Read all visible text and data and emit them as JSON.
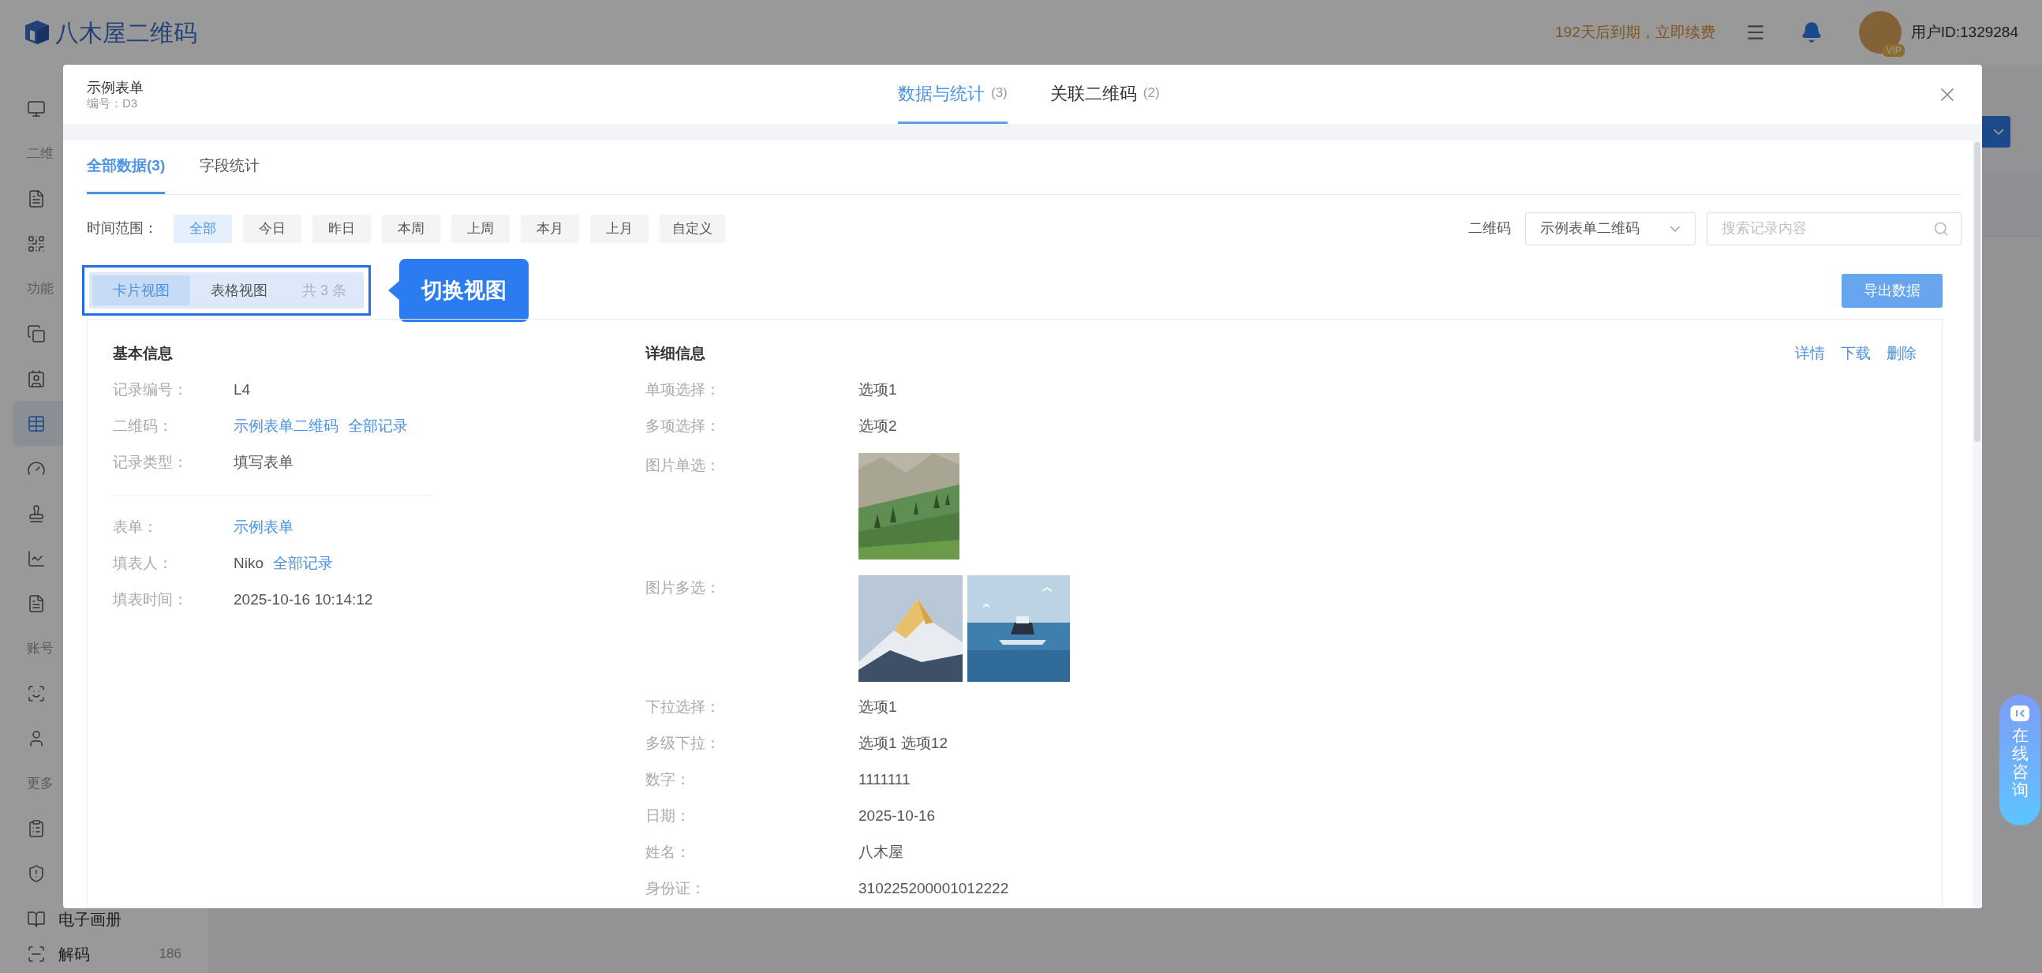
{
  "header": {
    "logo_text": "八木屋二维码",
    "renewal": "192天后到期，立即续费",
    "vip_badge": "VIP",
    "user_id": "用户ID:1329284"
  },
  "sidebar": {
    "items": [
      {
        "kind": "item",
        "selected": false
      },
      {
        "kind": "section",
        "label": "二维"
      },
      {
        "kind": "item",
        "selected": false
      },
      {
        "kind": "item",
        "selected": false
      },
      {
        "kind": "section",
        "label": "功能"
      },
      {
        "kind": "item",
        "selected": false
      },
      {
        "kind": "item",
        "selected": false
      },
      {
        "kind": "item",
        "selected": true
      },
      {
        "kind": "item",
        "selected": false
      },
      {
        "kind": "item",
        "selected": false
      },
      {
        "kind": "item",
        "selected": false
      },
      {
        "kind": "item",
        "selected": false
      },
      {
        "kind": "section",
        "label": "账号"
      },
      {
        "kind": "item",
        "selected": false
      },
      {
        "kind": "item",
        "selected": false
      },
      {
        "kind": "section",
        "label": "更多"
      },
      {
        "kind": "item",
        "selected": false
      },
      {
        "kind": "item",
        "selected": false
      },
      {
        "kind": "item",
        "selected": false,
        "label": "电子画册"
      },
      {
        "kind": "item",
        "selected": false,
        "label": "解码",
        "count": "186"
      }
    ]
  },
  "modal": {
    "title": "示例表单",
    "code": "编号：D3",
    "tabs": [
      {
        "label": "数据与统计",
        "count": "(3)",
        "selected": true
      },
      {
        "label": "关联二维码",
        "count": "(2)",
        "selected": false
      }
    ],
    "subtabs": [
      {
        "label": "全部数据(3)",
        "selected": true
      },
      {
        "label": "字段统计",
        "selected": false
      }
    ],
    "time_filter": {
      "label": "时间范围：",
      "options": [
        {
          "label": "全部",
          "selected": true
        },
        {
          "label": "今日",
          "selected": false
        },
        {
          "label": "昨日",
          "selected": false
        },
        {
          "label": "本周",
          "selected": false
        },
        {
          "label": "上周",
          "selected": false
        },
        {
          "label": "本月",
          "selected": false
        },
        {
          "label": "上月",
          "selected": false
        },
        {
          "label": "自定义",
          "selected": false
        }
      ]
    },
    "qr_filter": {
      "label": "二维码",
      "value": "示例表单二维码"
    },
    "search": {
      "placeholder": "搜索记录内容"
    },
    "view_toggle": {
      "options": [
        {
          "label": "卡片视图",
          "selected": true
        },
        {
          "label": "表格视图",
          "selected": false
        }
      ],
      "total": "共 3 条"
    },
    "callout": "切换视图",
    "export_button": "导出数据",
    "record": {
      "basic": {
        "title": "基本信息",
        "groups": [
          [
            {
              "label": "记录编号：",
              "values": [
                {
                  "kind": "text",
                  "text": "L4"
                }
              ]
            },
            {
              "label": "二维码：",
              "values": [
                {
                  "kind": "link",
                  "text": "示例表单二维码"
                },
                {
                  "kind": "link",
                  "text": "全部记录"
                }
              ]
            },
            {
              "label": "记录类型：",
              "values": [
                {
                  "kind": "text",
                  "text": "填写表单"
                }
              ]
            }
          ],
          [
            {
              "label": "表单：",
              "values": [
                {
                  "kind": "link",
                  "text": "示例表单"
                }
              ]
            },
            {
              "label": "填表人：",
              "values": [
                {
                  "kind": "text",
                  "text": "Niko"
                },
                {
                  "kind": "link",
                  "text": "全部记录"
                }
              ]
            },
            {
              "label": "填表时间：",
              "values": [
                {
                  "kind": "text",
                  "text": "2025-10-16 10:14:12"
                }
              ]
            }
          ]
        ]
      },
      "detail": {
        "title": "详细信息",
        "actions": [
          "详情",
          "下载",
          "删除"
        ],
        "rows": [
          {
            "label": "单项选择：",
            "kind": "text",
            "value": "选项1"
          },
          {
            "label": "多项选择：",
            "kind": "text",
            "value": "选项2"
          },
          {
            "label": "图片单选：",
            "kind": "images"
          },
          {
            "label": "图片多选：",
            "kind": "images"
          },
          {
            "label": "下拉选择：",
            "kind": "text",
            "value": "选项1"
          },
          {
            "label": "多级下拉：",
            "kind": "text",
            "value": "选项1 选项12"
          },
          {
            "label": "数字：",
            "kind": "text",
            "value": "1111111"
          },
          {
            "label": "日期：",
            "kind": "text",
            "value": "2025-10-16"
          },
          {
            "label": "姓名：",
            "kind": "text",
            "value": "八木屋"
          },
          {
            "label": "身份证：",
            "kind": "text",
            "value": "310225200001012222"
          }
        ]
      }
    }
  },
  "consult_button": "在线咨询"
}
